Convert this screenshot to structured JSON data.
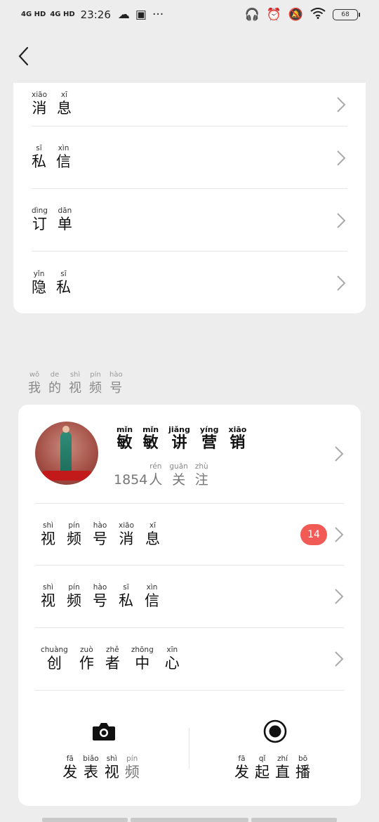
{
  "status_bar": {
    "signal1": "4G HD",
    "signal2": "4G HD",
    "time": "23:26",
    "battery": "68",
    "icons": [
      "cloud-icon",
      "bag-icon",
      "more-icon",
      "headphones-icon",
      "alarm-icon",
      "mute-icon",
      "wifi-icon"
    ]
  },
  "menu_top": [
    {
      "py": [
        "xiāo",
        "xī"
      ],
      "hz": [
        "消",
        "息"
      ]
    },
    {
      "py": [
        "sī",
        "xìn"
      ],
      "hz": [
        "私",
        "信"
      ]
    },
    {
      "py": [
        "dìng",
        "dān"
      ],
      "hz": [
        "订",
        "单"
      ]
    },
    {
      "py": [
        "yǐn",
        "sī"
      ],
      "hz": [
        "隐",
        "私"
      ]
    }
  ],
  "section_title": {
    "py": [
      "wǒ",
      "de",
      "shì",
      "pín",
      "hào"
    ],
    "hz": [
      "我",
      "的",
      "视",
      "频",
      "号"
    ]
  },
  "channel": {
    "name": {
      "py": [
        "mǐn",
        "mǐn",
        "jiǎng",
        "yíng",
        "xiāo"
      ],
      "hz": [
        "敏",
        "敏",
        "讲",
        "营",
        "销"
      ]
    },
    "follower_count": "1854",
    "follower_suffix": {
      "py": [
        "rén",
        "guān",
        "zhù"
      ],
      "hz": [
        "人",
        "关",
        "注"
      ]
    }
  },
  "channel_menu": [
    {
      "py": [
        "shì",
        "pín",
        "hào",
        "xiāo",
        "xī"
      ],
      "hz": [
        "视",
        "频",
        "号",
        "消",
        "息"
      ],
      "badge": "14"
    },
    {
      "py": [
        "shì",
        "pín",
        "hào",
        "sī",
        "xìn"
      ],
      "hz": [
        "视",
        "频",
        "号",
        "私",
        "信"
      ]
    },
    {
      "py": [
        "chuàng",
        "zuò",
        "zhě",
        "zhōng",
        "xīn"
      ],
      "hz": [
        "创",
        "作",
        "者",
        "中",
        "心"
      ]
    }
  ],
  "actions": [
    {
      "icon": "camera-icon",
      "py": [
        "fā",
        "biǎo",
        "shì",
        "pín"
      ],
      "hz": [
        "发",
        "表",
        "视",
        "频"
      ]
    },
    {
      "icon": "live-record-icon",
      "py": [
        "fā",
        "qǐ",
        "zhí",
        "bō"
      ],
      "hz": [
        "发",
        "起",
        "直",
        "播"
      ]
    }
  ],
  "colors": {
    "background": "#ededed",
    "card": "#ffffff",
    "badge": "#f25b55",
    "divider": "#e6e6e6"
  }
}
